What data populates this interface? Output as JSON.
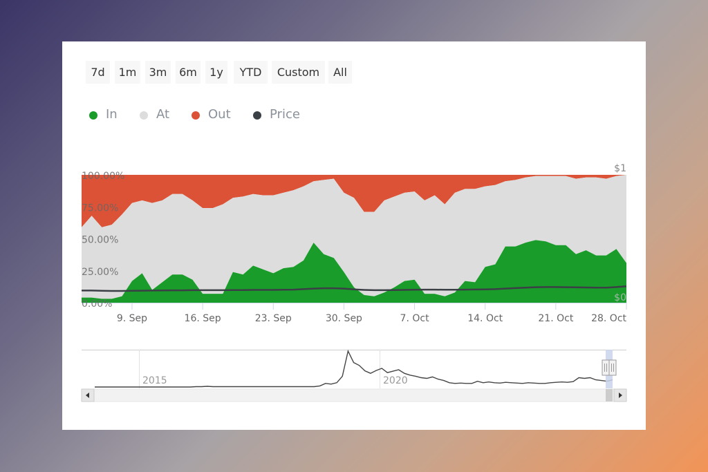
{
  "range_selector": {
    "buttons": [
      "7d",
      "1m",
      "3m",
      "6m",
      "1y",
      "YTD",
      "Custom",
      "All"
    ]
  },
  "legend": [
    {
      "label": "In",
      "color": "#1a9c2a"
    },
    {
      "label": "At",
      "color": "#dddddd"
    },
    {
      "label": "Out",
      "color": "#dc5236"
    },
    {
      "label": "Price",
      "color": "#3b3f46"
    }
  ],
  "chart_data": {
    "type": "area",
    "stacking": "percent",
    "title": "",
    "xlabel": "",
    "ylabel": "",
    "ylim": [
      0,
      100
    ],
    "y_ticks": [
      "0.00%",
      "25.00%",
      "50.00%",
      "75.00%",
      "100.00%"
    ],
    "y2_ticks": [
      "$0",
      "$1"
    ],
    "y2lim": [
      0,
      1
    ],
    "x_ticks": [
      "9. Sep",
      "16. Sep",
      "23. Sep",
      "30. Sep",
      "7. Oct",
      "14. Oct",
      "21. Oct",
      "28. Oct"
    ],
    "x_tick_day_index": [
      5,
      12,
      19,
      26,
      33,
      40,
      47,
      54
    ],
    "x_start": "4 Sep",
    "x_end": "28 Oct",
    "grid": false,
    "legend_position": "top-left",
    "series": [
      {
        "name": "In",
        "color": "#1a9c2a",
        "values": [
          4,
          4,
          3,
          3,
          5,
          17,
          23,
          10,
          16,
          22,
          22,
          18,
          7,
          7,
          7,
          24,
          22,
          29,
          26,
          23,
          27,
          28,
          33,
          47,
          38,
          35,
          24,
          12,
          6,
          5,
          8,
          12,
          17,
          18,
          7,
          7,
          5,
          8,
          17,
          16,
          28,
          30,
          44,
          44,
          47,
          49,
          48,
          45,
          45,
          38,
          41,
          37,
          37,
          42,
          31
        ]
      },
      {
        "name": "At",
        "color": "#dddddd",
        "values": [
          55,
          64,
          56,
          58,
          64,
          61,
          57,
          68,
          64,
          63,
          63,
          62,
          67,
          67,
          70,
          58,
          61,
          56,
          58,
          61,
          59,
          60,
          58,
          48,
          58,
          62,
          62,
          70,
          65,
          66,
          72,
          71,
          69,
          69,
          73,
          77,
          72,
          78,
          72,
          73,
          63,
          62,
          51,
          52,
          51,
          50,
          51,
          54,
          54,
          59,
          57,
          61,
          60,
          57,
          69
        ]
      },
      {
        "name": "Out",
        "color": "#dc5236",
        "values": [
          41,
          32,
          41,
          39,
          31,
          22,
          20,
          22,
          20,
          15,
          15,
          20,
          26,
          26,
          23,
          18,
          17,
          15,
          16,
          16,
          14,
          12,
          9,
          5,
          4,
          3,
          14,
          18,
          29,
          29,
          20,
          17,
          14,
          13,
          20,
          16,
          23,
          14,
          11,
          11,
          9,
          8,
          5,
          4,
          2,
          1,
          1,
          1,
          1,
          3,
          2,
          2,
          3,
          1,
          0
        ]
      },
      {
        "name": "Price",
        "color": "#3b3f46",
        "axis": "right",
        "values": [
          0.095,
          0.095,
          0.093,
          0.092,
          0.092,
          0.093,
          0.094,
          0.095,
          0.096,
          0.097,
          0.097,
          0.098,
          0.098,
          0.098,
          0.098,
          0.099,
          0.099,
          0.1,
          0.1,
          0.1,
          0.101,
          0.102,
          0.106,
          0.11,
          0.113,
          0.113,
          0.11,
          0.104,
          0.1,
          0.098,
          0.098,
          0.099,
          0.1,
          0.101,
          0.102,
          0.102,
          0.101,
          0.101,
          0.102,
          0.103,
          0.104,
          0.106,
          0.11,
          0.114,
          0.118,
          0.121,
          0.122,
          0.122,
          0.121,
          0.12,
          0.119,
          0.118,
          0.118,
          0.122,
          0.128
        ]
      }
    ],
    "navigator": {
      "x_labels": [
        "2015",
        "2020"
      ],
      "values": [
        0,
        0,
        0,
        0,
        0,
        0,
        0,
        0,
        0,
        0,
        0,
        0,
        0,
        0,
        0,
        0,
        0,
        0,
        0.01,
        0.01,
        0.02,
        0.01,
        0.01,
        0.01,
        0.01,
        0.01,
        0.01,
        0.01,
        0.01,
        0.01,
        0.01,
        0.01,
        0.01,
        0.01,
        0.01,
        0.01,
        0.01,
        0.01,
        0.01,
        0.01,
        0.03,
        0.1,
        0.08,
        0.12,
        0.3,
        1.0,
        0.68,
        0.6,
        0.45,
        0.38,
        0.46,
        0.52,
        0.4,
        0.44,
        0.48,
        0.38,
        0.33,
        0.3,
        0.26,
        0.24,
        0.28,
        0.22,
        0.18,
        0.12,
        0.1,
        0.11,
        0.1,
        0.1,
        0.16,
        0.12,
        0.14,
        0.12,
        0.11,
        0.13,
        0.12,
        0.11,
        0.1,
        0.12,
        0.11,
        0.1,
        0.1,
        0.12,
        0.13,
        0.14,
        0.13,
        0.15,
        0.26,
        0.24,
        0.26,
        0.2,
        0.18,
        0.16,
        0.2
      ]
    }
  }
}
